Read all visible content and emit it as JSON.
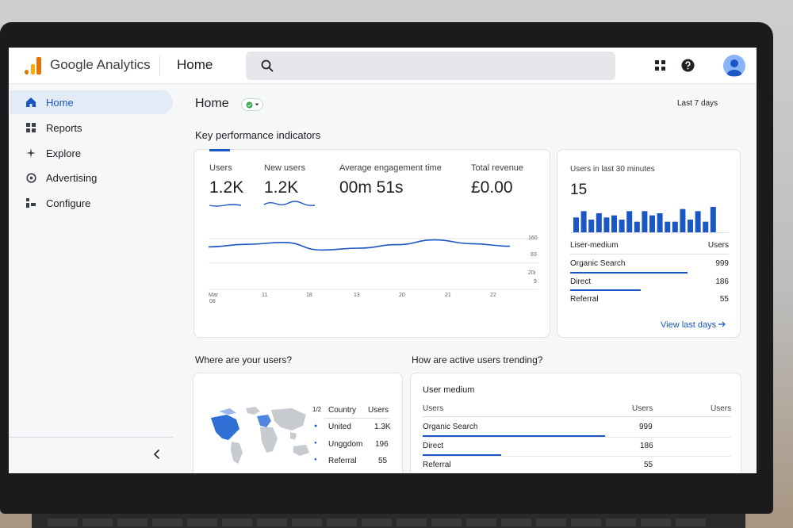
{
  "app": {
    "brand": "Google Analytics",
    "section_title": "Home"
  },
  "colors": {
    "accent": "#1a56c4",
    "logo_orange": "#f9ab00",
    "logo_dark_orange": "#e37400"
  },
  "icons": [
    "search-icon",
    "apps-grid-icon",
    "help-icon",
    "avatar-icon",
    "home-icon",
    "reports-icon",
    "explore-icon",
    "advertising-icon",
    "configure-icon",
    "chevron-left-icon",
    "arrow-right-icon"
  ],
  "sidebar": {
    "items": [
      {
        "label": "Home",
        "active": true
      },
      {
        "label": "Reports"
      },
      {
        "label": "Explore"
      },
      {
        "label": "Advertising"
      },
      {
        "label": "Configure"
      }
    ]
  },
  "page": {
    "title": "Home",
    "date_range": "Last 7 days",
    "kpi_heading": "Key performance indicators"
  },
  "kpis": [
    {
      "label": "Users",
      "value": "1.2K"
    },
    {
      "label": "New users",
      "value": "1.2K"
    },
    {
      "label": "Average engagement time",
      "value": "00m 51s"
    },
    {
      "label": "Total revenue",
      "value": "£0.00"
    }
  ],
  "chart_data": {
    "type": "line",
    "x": [
      "Mar 08",
      "11",
      "18",
      "13",
      "20",
      "21",
      "22"
    ],
    "x_month_label": "Mar",
    "x_first_day": "08",
    "y_ticks": [
      "160",
      "83",
      "20i",
      "9"
    ],
    "series": [
      {
        "values": [
          84,
          92,
          98,
          74,
          80,
          91,
          106,
          94,
          86
        ]
      }
    ],
    "ylim": [
      0,
      170
    ],
    "grid": true
  },
  "realtime": {
    "label": "Users in last 30 minutes",
    "value": "15",
    "bars": [
      7,
      10,
      6,
      9,
      7,
      8,
      6,
      10,
      5,
      10,
      8,
      9,
      5,
      5,
      11,
      6,
      10,
      5,
      12
    ],
    "header_left": "Liser-medium",
    "header_right": "Users",
    "rows": [
      {
        "label": "Organic Search",
        "value": "999",
        "share": 1.0
      },
      {
        "label": "Direct",
        "value": "186",
        "share": 0.6
      },
      {
        "label": "Referral",
        "value": "55",
        "share": 0
      }
    ],
    "link": "View last days"
  },
  "where_users": {
    "heading": "Where are your users?",
    "page_indicator": "1/2",
    "col_country": "Country",
    "col_users": "Users",
    "rows": [
      {
        "label": "United",
        "value": "1.3K"
      },
      {
        "label": "Unggdom",
        "value": "196"
      },
      {
        "label": "Referral",
        "value": "55"
      }
    ]
  },
  "trending": {
    "heading": "How are active users trending?",
    "card_title": "User medium",
    "col_left": "Users",
    "col_mid": "Users",
    "col_right": "Users",
    "rows": [
      {
        "label": "Organic Search",
        "value": "999",
        "share": 1.0
      },
      {
        "label": "Direct",
        "value": "186",
        "share": 0.43
      },
      {
        "label": "Referral",
        "value": "55",
        "share": 0
      }
    ]
  }
}
